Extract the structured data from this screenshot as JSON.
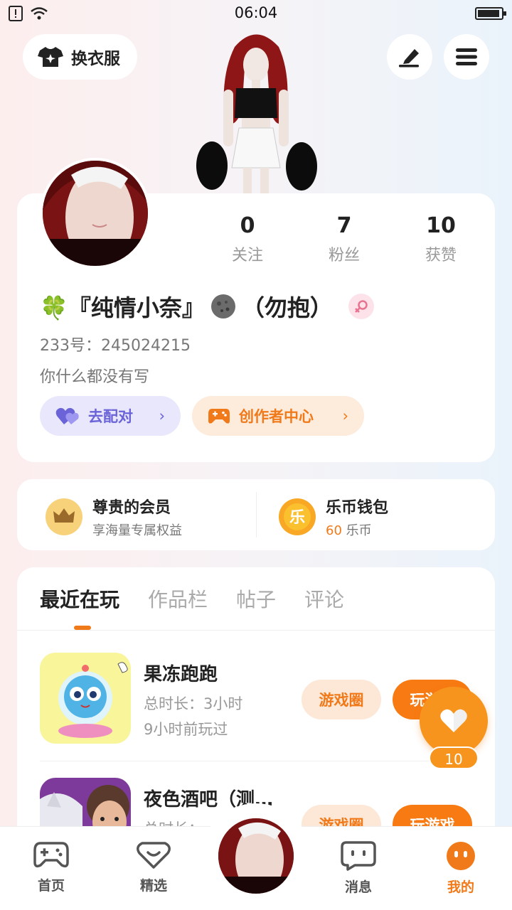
{
  "status_bar": {
    "time": "06:04"
  },
  "top_bar": {
    "dress_label": "换衣服"
  },
  "profile": {
    "stats": [
      {
        "value": "0",
        "label": "关注"
      },
      {
        "value": "7",
        "label": "粉丝"
      },
      {
        "value": "10",
        "label": "获赞"
      }
    ],
    "nickname_prefix": "🍀『纯情小奈』",
    "nickname_suffix": "（勿抱）",
    "uid": "233号：245024215",
    "bio": "你什么都没有写",
    "match_label": "去配对",
    "creator_label": "创作者中心"
  },
  "vip": {
    "member_title": "尊贵的会员",
    "member_sub": "享海量专属权益",
    "wallet_title": "乐币钱包",
    "coin_count": "60",
    "coin_unit": "乐币",
    "coin_glyph": "乐"
  },
  "tabs": [
    "最近在玩",
    "作品栏",
    "帖子",
    "评论"
  ],
  "games": [
    {
      "name": "果冻跑跑",
      "duration": "总时长：3小时",
      "last_played": "9小时前玩过",
      "circle_label": "游戏圈",
      "play_label": "玩游戏"
    },
    {
      "name": "夜色酒吧（测…",
      "duration": "总时长：",
      "circle_label": "游戏圈",
      "play_label": "玩游戏"
    }
  ],
  "float_like": {
    "count": "10"
  },
  "bottom_nav": {
    "home": "首页",
    "featured": "精选",
    "messages": "消息",
    "mine": "我的"
  },
  "colors": {
    "accent": "#f07a1a",
    "purple": "#6b63d8"
  }
}
